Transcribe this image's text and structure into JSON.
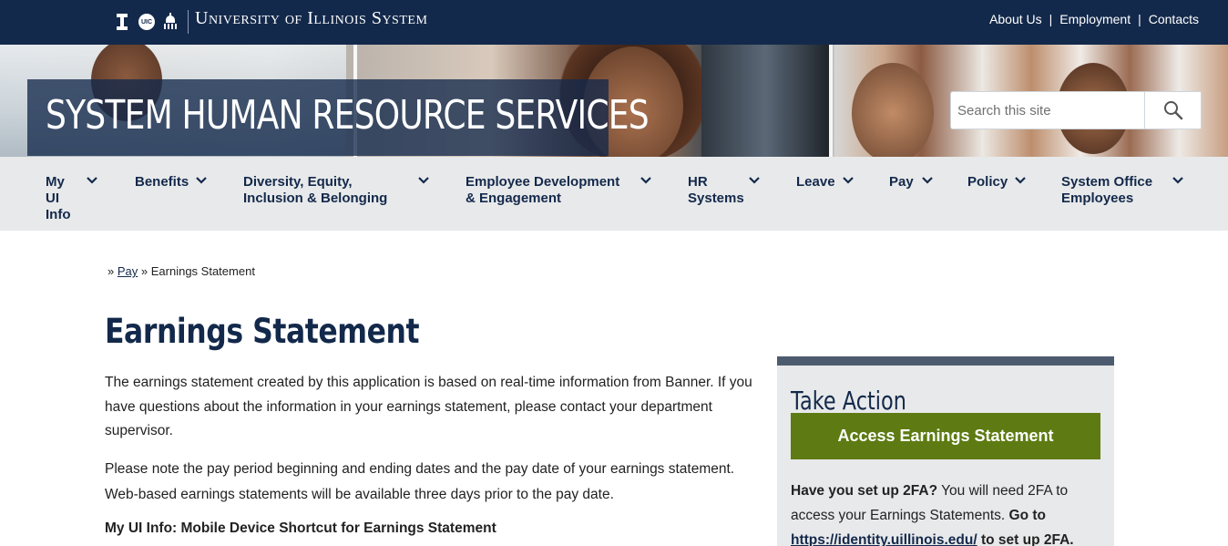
{
  "header": {
    "uic_logo_text": "UIC",
    "system_name": "University of Illinois System",
    "utility_links": [
      "About Us",
      "Employment",
      "Contacts"
    ],
    "separator": "|"
  },
  "hero": {
    "site_title": "SYSTEM HUMAN RESOURCE SERVICES"
  },
  "search": {
    "placeholder": "Search this site"
  },
  "nav": {
    "items": [
      {
        "label": "My UI Info"
      },
      {
        "label": "Benefits"
      },
      {
        "label": "Diversity, Equity, Inclusion & Belonging"
      },
      {
        "label": "Employee Development & Engagement"
      },
      {
        "label": "HR Systems"
      },
      {
        "label": "Leave"
      },
      {
        "label": "Pay"
      },
      {
        "label": "Policy"
      },
      {
        "label": "System Office Employees"
      }
    ]
  },
  "breadcrumb": {
    "prefix": "»",
    "link": "Pay",
    "separator": "»",
    "current": "Earnings Statement"
  },
  "main": {
    "title": "Earnings Statement",
    "paragraph1": "The earnings statement created by this application is based on real-time information from Banner. If you have questions about the information in your earnings statement, please contact your department supervisor.",
    "paragraph2": "Please note the pay period beginning and ending dates and the pay date of your earnings statement. Web-based earnings statements will be available three days prior to the pay date.",
    "subheading": "My UI Info: Mobile Device Shortcut for Earnings Statement"
  },
  "sidebar": {
    "title": "Take Action",
    "button_label": "Access Earnings Statement",
    "text_bold1": "Have you set up 2FA?",
    "text_normal": " You will need 2FA to access your Earnings Statements. ",
    "text_bold2": "Go to",
    "link": "https://identity.uillinois.edu/",
    "text_bold3": " to set up 2FA."
  },
  "colors": {
    "navy": "#13294b",
    "nav_bg": "#e8e9ea",
    "action_green": "#5d7b12"
  }
}
